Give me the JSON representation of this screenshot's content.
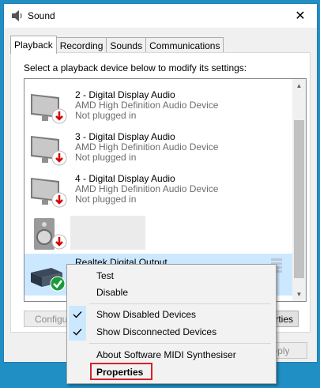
{
  "window": {
    "title": "Sound",
    "close_label": "✕"
  },
  "tabs": [
    {
      "label": "Playback",
      "active": true
    },
    {
      "label": "Recording",
      "active": false
    },
    {
      "label": "Sounds",
      "active": false
    },
    {
      "label": "Communications",
      "active": false
    }
  ],
  "panel": {
    "instruction": "Select a playback device below to modify its settings:"
  },
  "devices": [
    {
      "name": "2 - Digital Display Audio",
      "driver": "AMD High Definition Audio Device",
      "status": "Not plugged in",
      "icon": "monitor-icon",
      "badge": "unplugged-arrow-icon"
    },
    {
      "name": "3 - Digital Display Audio",
      "driver": "AMD High Definition Audio Device",
      "status": "Not plugged in",
      "icon": "monitor-icon",
      "badge": "unplugged-arrow-icon"
    },
    {
      "name": "4 - Digital Display Audio",
      "driver": "AMD High Definition Audio Device",
      "status": "Not plugged in",
      "icon": "monitor-icon",
      "badge": "unplugged-arrow-icon"
    },
    {
      "name": "",
      "driver": "",
      "status": "",
      "icon": "speaker-icon",
      "badge": "unplugged-arrow-icon"
    },
    {
      "name": "Realtek Digital Output",
      "driver": "",
      "status": "",
      "icon": "digital-output-icon",
      "badge": "default-check-icon",
      "selected": true
    }
  ],
  "buttons": {
    "configure": "Configure",
    "properties_partial": "rties",
    "apply": "Apply"
  },
  "context_menu": {
    "items": [
      {
        "label": "Test",
        "checked": false,
        "bold": false
      },
      {
        "label": "Disable",
        "checked": false,
        "bold": false
      },
      {
        "label": "Show Disabled Devices",
        "checked": true,
        "bold": false
      },
      {
        "label": "Show Disconnected Devices",
        "checked": true,
        "bold": false
      },
      {
        "label": "About Software MIDI Synthesiser",
        "checked": false,
        "bold": false
      },
      {
        "label": "Properties",
        "checked": false,
        "bold": true
      }
    ]
  },
  "colors": {
    "accent": "#0078d7",
    "selection": "#cce8ff",
    "highlight_border": "#d2232a",
    "desktop": "#1f8fc4"
  }
}
